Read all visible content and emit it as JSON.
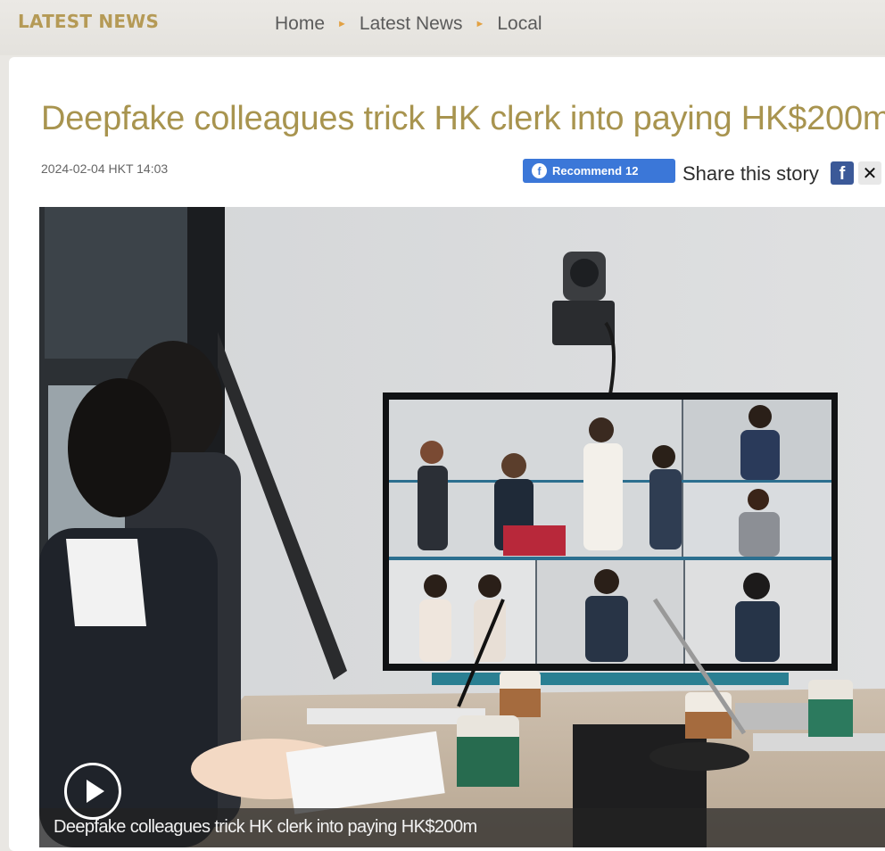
{
  "header": {
    "section_title": "LATEST NEWS",
    "breadcrumb": [
      "Home",
      "Latest News",
      "Local"
    ]
  },
  "article": {
    "headline": "Deepfake colleagues trick HK clerk into paying HK$200m",
    "timestamp": "2024-02-04 HKT 14:03",
    "recommend": {
      "label": "Recommend",
      "count": "12"
    },
    "share_label": "Share this story",
    "video": {
      "caption": "Deepfake colleagues trick HK clerk into paying HK$200m"
    }
  },
  "icons": {
    "facebook": "facebook-icon",
    "x": "x-icon",
    "play": "play-icon"
  },
  "colors": {
    "accent_gold": "#b59a56",
    "headline_gold": "#a8944f",
    "facebook_blue": "#3b77d8"
  }
}
